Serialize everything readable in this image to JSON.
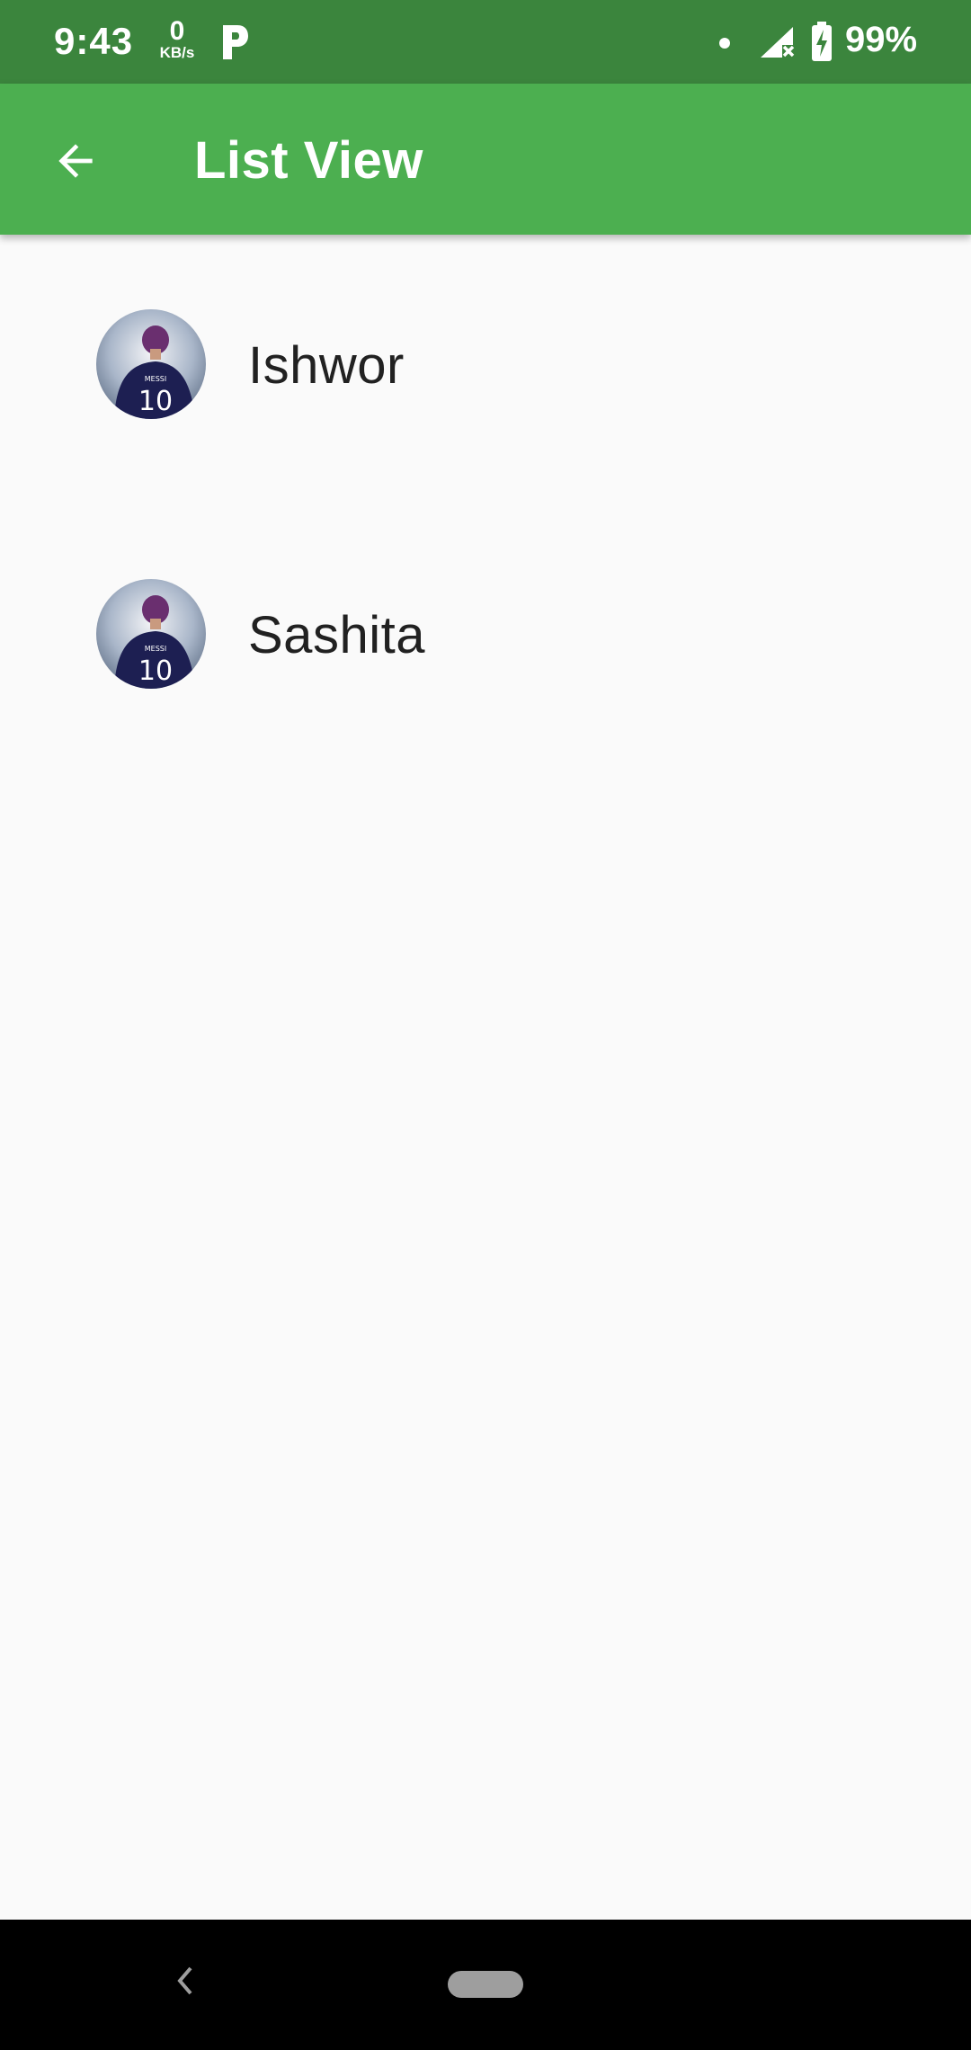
{
  "status_bar": {
    "time": "9:43",
    "net_speed_value": "0",
    "net_speed_unit": "KB/s",
    "battery_percent": "99%",
    "icons": [
      "parking-icon",
      "notification-dot-icon",
      "signal-no-data-icon",
      "battery-charging-icon"
    ]
  },
  "app_bar": {
    "title": "List View",
    "back_icon": "arrow-back-icon",
    "color": "#4caf50"
  },
  "list": {
    "items": [
      {
        "name": "Ishwor",
        "avatar": "avatar-image-icon"
      },
      {
        "name": "Sashita",
        "avatar": "avatar-image-icon"
      }
    ]
  },
  "nav_bar": {
    "back_icon": "chevron-left-icon",
    "home_icon": "home-pill-icon"
  }
}
